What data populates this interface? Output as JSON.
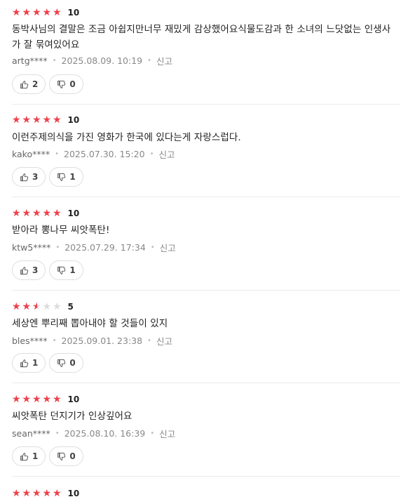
{
  "reviews": [
    {
      "rating": 5,
      "score": "10",
      "text": "동박사님의 결말은 조금 아쉽지만너무 재밌게 감상했어요식물도감과 한 소녀의 느닷없는 인생사가 잘 묶여있어요",
      "user": "artg****",
      "date": "2025.08.09. 10:19",
      "report": "신고",
      "likes": "2",
      "dislikes": "0"
    },
    {
      "rating": 5,
      "score": "10",
      "text": "이런주제의식을 가진 영화가 한국에 있다는게 자랑스럽다.",
      "user": "kako****",
      "date": "2025.07.30. 15:20",
      "report": "신고",
      "likes": "3",
      "dislikes": "1"
    },
    {
      "rating": 5,
      "score": "10",
      "text": "받아라 뽕나무 씨앗폭탄!",
      "user": "ktw5****",
      "date": "2025.07.29. 17:34",
      "report": "신고",
      "likes": "3",
      "dislikes": "1"
    },
    {
      "rating": 2.5,
      "score": "5",
      "text": "세상엔 뿌리째 뽑아내야 할 것들이 있지",
      "user": "bles****",
      "date": "2025.09.01. 23:38",
      "report": "신고",
      "likes": "1",
      "dislikes": "0"
    },
    {
      "rating": 5,
      "score": "10",
      "text": "씨앗폭탄 던지기가 인상깊어요",
      "user": "sean****",
      "date": "2025.08.10. 16:39",
      "report": "신고",
      "likes": "1",
      "dislikes": "0"
    },
    {
      "rating": 5,
      "score": "10",
      "text": "",
      "user": "",
      "date": "",
      "report": "",
      "likes": "",
      "dislikes": ""
    }
  ],
  "colors": {
    "star_active": "#f0404b",
    "star_inactive": "#dcdcdc"
  },
  "icons": {
    "like": "thumbs-up-icon",
    "dislike": "thumbs-down-icon"
  }
}
